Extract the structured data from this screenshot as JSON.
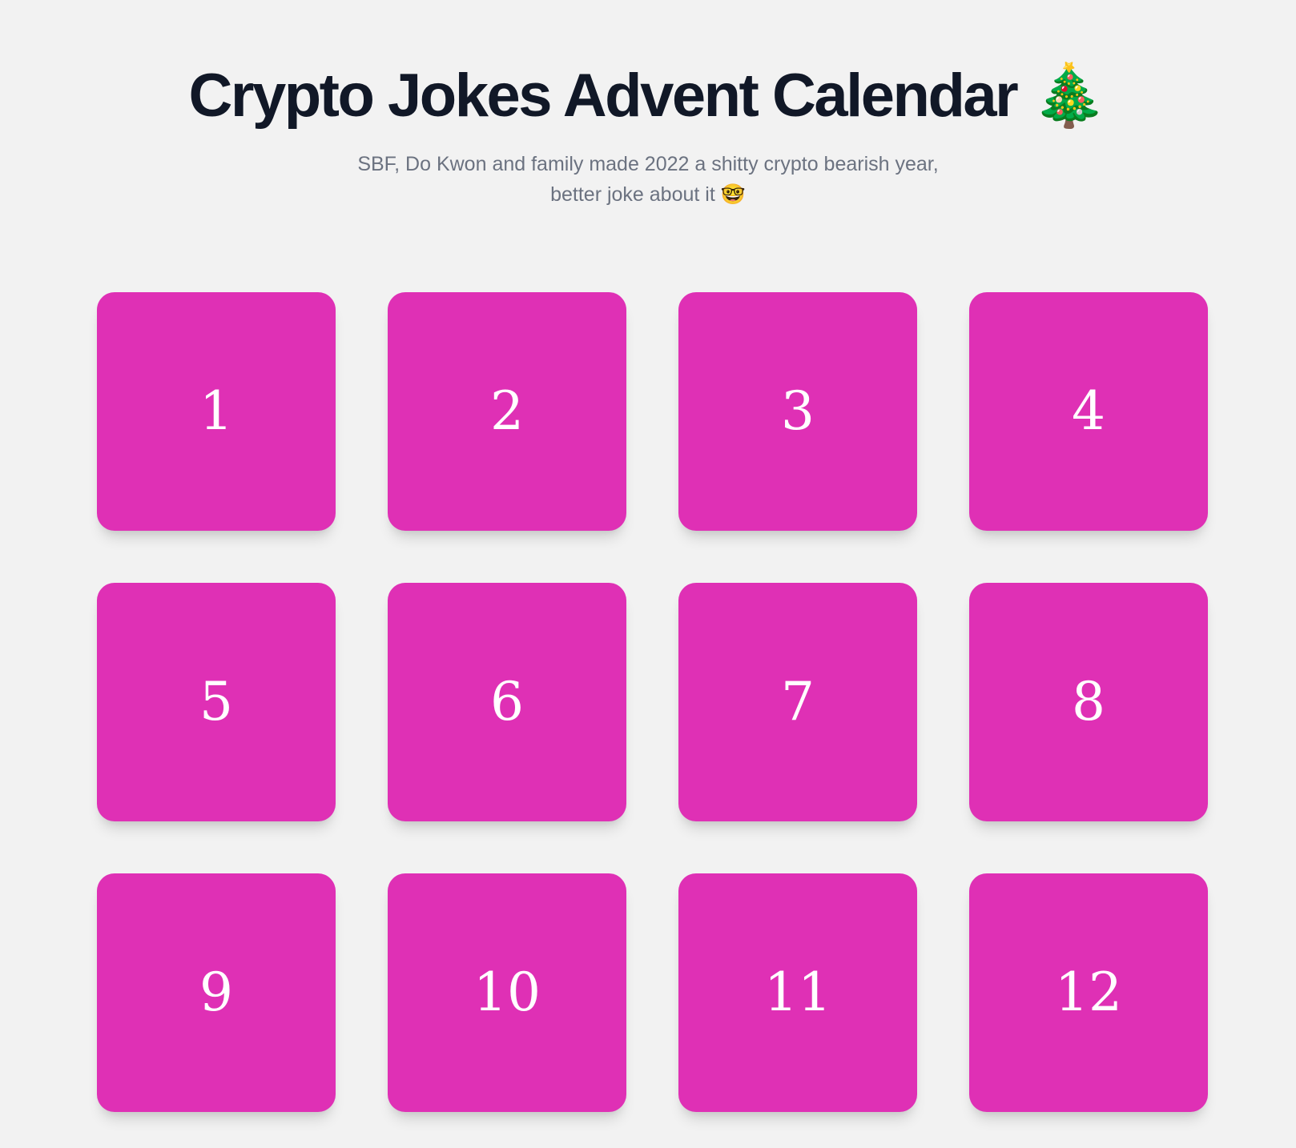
{
  "header": {
    "title": "Crypto Jokes Advent Calendar",
    "title_emoji": "🎄",
    "subtitle_line1": "SBF, Do Kwon and family made 2022 a shitty crypto bearish year,",
    "subtitle_line2": "better joke about it",
    "subtitle_emoji": "🤓"
  },
  "colors": {
    "background": "#f2f2f2",
    "door": "#df30b5",
    "title": "#111827",
    "subtitle": "#6b7280",
    "door_text": "#ffffff"
  },
  "doors": [
    {
      "label": "1"
    },
    {
      "label": "2"
    },
    {
      "label": "3"
    },
    {
      "label": "4"
    },
    {
      "label": "5"
    },
    {
      "label": "6"
    },
    {
      "label": "7"
    },
    {
      "label": "8"
    },
    {
      "label": "9"
    },
    {
      "label": "10"
    },
    {
      "label": "11"
    },
    {
      "label": "12"
    }
  ]
}
